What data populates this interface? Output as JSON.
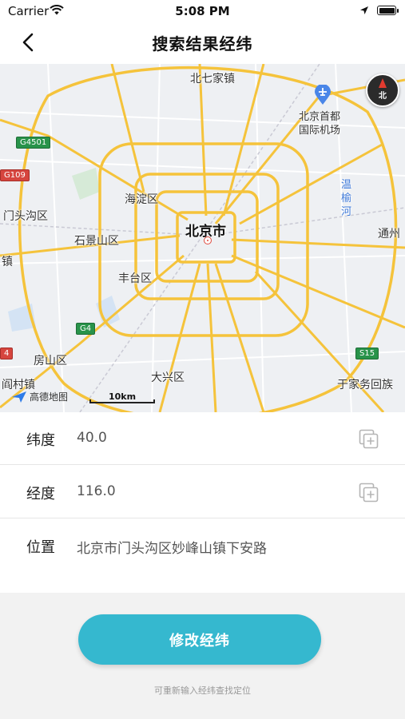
{
  "status_bar": {
    "carrier": "Carrier",
    "time": "5:08 PM"
  },
  "nav": {
    "title": "搜索结果经纬"
  },
  "map": {
    "labels": {
      "beiqijia": "北七家镇",
      "airport_line1": "北京首都",
      "airport_line2": "国际机场",
      "haidian": "海淀区",
      "beijing": "北京市",
      "mentougou": "门头沟区",
      "shijingshan": "石景山区",
      "fengtai": "丰台区",
      "tongzhou": "通州",
      "wenyu_1": "温",
      "wenyu_2": "榆",
      "wenyu_3": "河",
      "fangshan": "房山区",
      "daxing": "大兴区",
      "yujiawu": "于家务回族",
      "yancun": "阎村镇",
      "zhen_left": "镇"
    },
    "shields": {
      "g4501": "G4501",
      "g109": "G109",
      "g4": "G4",
      "s15": "S15",
      "left_4": "4"
    },
    "compass_label": "北",
    "logo_text": "高德地图",
    "scale_text": "10km"
  },
  "info": {
    "latitude_label": "纬度",
    "latitude_value": "40.0",
    "longitude_label": "经度",
    "longitude_value": "116.0",
    "location_label": "位置",
    "location_value": "北京市门头沟区妙峰山镇下安路"
  },
  "actions": {
    "modify_button": "修改经纬",
    "hint": "可重新输入经纬查找定位"
  }
}
